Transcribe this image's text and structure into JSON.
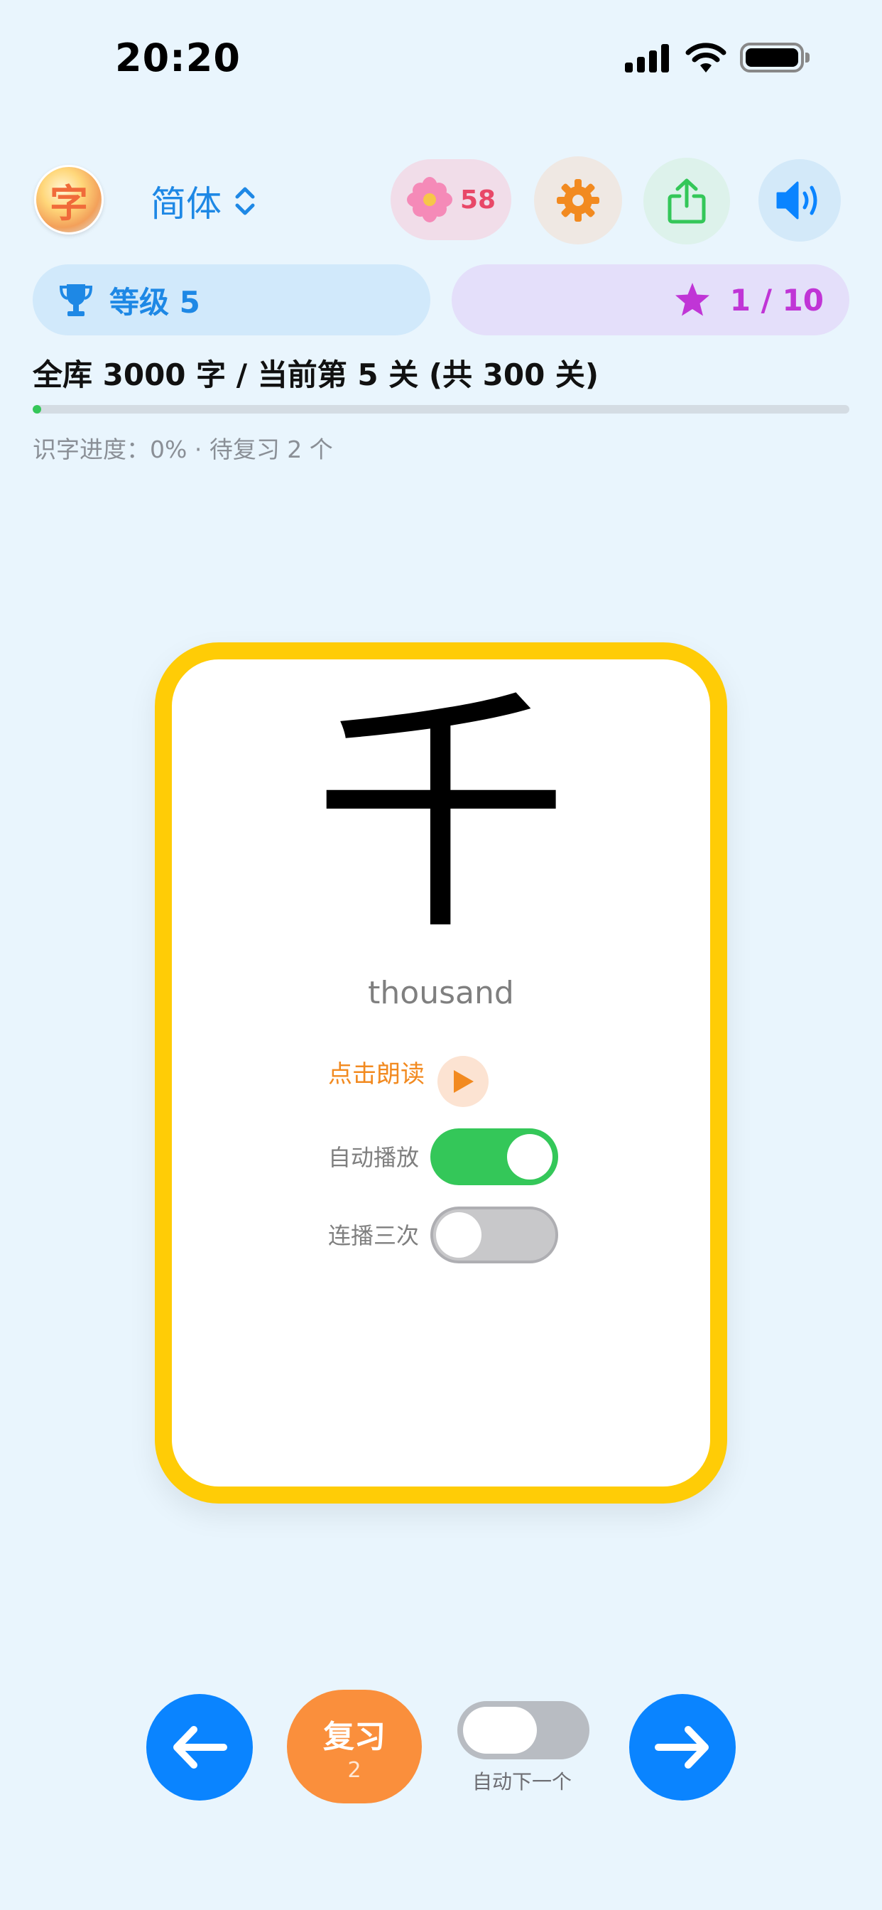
{
  "status_bar": {
    "time": "20:20",
    "battery_level": 1.0
  },
  "header": {
    "avatar_glyph": "字",
    "script_label": "简体",
    "flower_count": "58",
    "icons": [
      "flower-icon",
      "gear-icon",
      "share-icon",
      "speaker-icon"
    ]
  },
  "level": {
    "label": "等级 5"
  },
  "stars": {
    "label": "1 / 10"
  },
  "library": {
    "text": "全库 3000 字 / 当前第 5 关 (共 300 关)",
    "progress_fraction": 0.01,
    "progress_text": "识字进度：0% · 待复习 2 个"
  },
  "card": {
    "character": "千",
    "meaning": "thousand",
    "read_label": "点击朗读",
    "auto_play_label": "自动播放",
    "auto_play_on": true,
    "repeat_three_label": "连播三次",
    "repeat_three_on": false
  },
  "bottom": {
    "review_label": "复习",
    "review_count": "2",
    "auto_next_label": "自动下一个",
    "auto_next_on": false
  },
  "colors": {
    "background": "#E9F5FD",
    "card_border": "#FFCC06",
    "primary_blue": "#0A84FF",
    "review_orange": "#FA8F3C",
    "toggle_on": "#34C759"
  }
}
